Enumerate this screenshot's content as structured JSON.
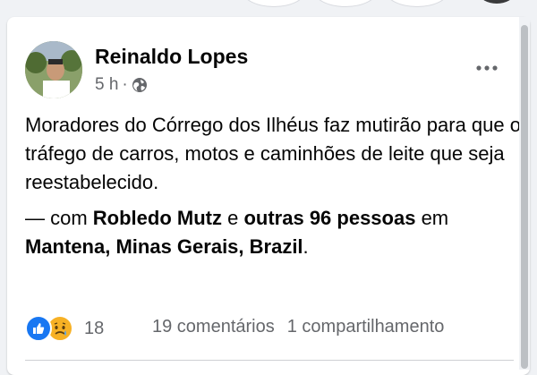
{
  "post": {
    "author": "Reinaldo Lopes",
    "time": "5 h",
    "separator": "·",
    "privacy_icon": "globe-icon",
    "text": "Moradores do Córrego dos Ilhéus faz mutirão para que o tráfego de carros, motos e caminhões de leite que seja reestabelecido.",
    "tag_prefix": "— com ",
    "tag_person": "Robledo Mutz",
    "tag_mid": " e ",
    "tag_others": "outras 96 pessoas",
    "tag_at": " em ",
    "tag_location": "Mantena, Minas Gerais, Brazil",
    "tag_end": "."
  },
  "engagement": {
    "reaction_icons": [
      "like-icon",
      "sad-icon"
    ],
    "reaction_count": "18",
    "comments": "19 comentários",
    "shares": "1 compartilhamento"
  },
  "colors": {
    "page_bg": "#f0f2f5",
    "card_bg": "#ffffff",
    "primary_text": "#050505",
    "secondary_text": "#65676b",
    "like_blue": "#1877f2",
    "sad_yellow": "#f7b125"
  }
}
